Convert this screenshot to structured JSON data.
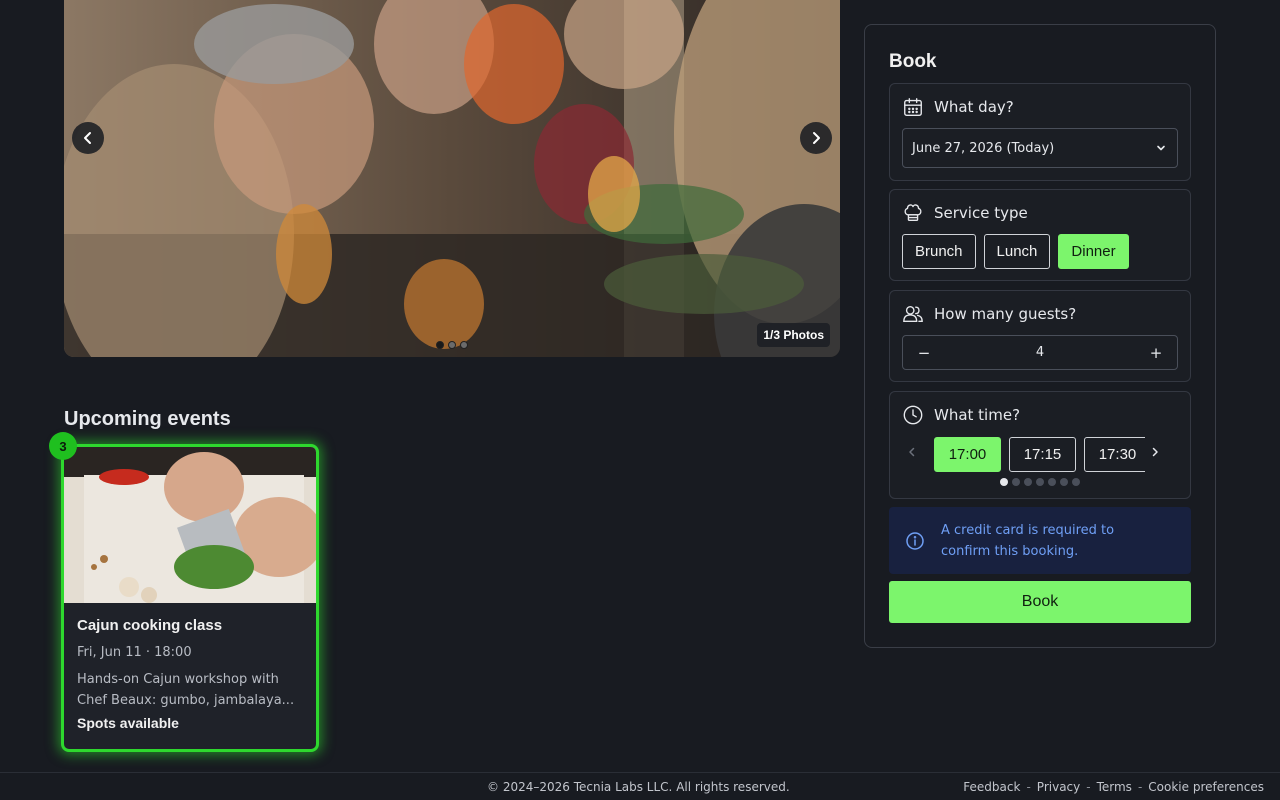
{
  "carousel": {
    "prev_icon": "chevron-left-icon",
    "next_icon": "chevron-right-icon",
    "photo_count": "1/3 Photos",
    "dots": 3,
    "active_dot": 0
  },
  "events": {
    "title": "Upcoming events",
    "badge_count": "3",
    "items": [
      {
        "name": "Cajun cooking class",
        "date": "Fri, Jun 11 · 18:00",
        "description": "Hands-on Cajun workshop with Chef Beaux: gumbo, jambalaya...",
        "availability": "Spots available"
      }
    ]
  },
  "booking": {
    "title": "Book",
    "day": {
      "label": "What day?",
      "icon": "calendar-icon",
      "selected": "June 27, 2026 (Today)"
    },
    "service": {
      "label": "Service type",
      "icon": "chef-hat-icon",
      "options": [
        "Brunch",
        "Lunch",
        "Dinner"
      ],
      "selected": "Dinner"
    },
    "guests": {
      "label": "How many guests?",
      "icon": "users-icon",
      "value": "4",
      "decrement": "−",
      "increment": "+"
    },
    "time": {
      "label": "What time?",
      "icon": "clock-icon",
      "slots": [
        "17:00",
        "17:15",
        "17:30"
      ],
      "selected": "17:00",
      "page_dots": 7,
      "active_page": 0
    },
    "notice": "A credit card is required to confirm this booking.",
    "submit_label": "Book"
  },
  "footer": {
    "copyright": "© 2024–2026 Tecnia Labs LLC. All rights reserved.",
    "links": [
      "Feedback",
      "Privacy",
      "Terms",
      "Cookie preferences"
    ],
    "separator": "-"
  },
  "colors": {
    "accent": "#7cf56c",
    "highlight_border": "#2ed82e",
    "background": "#181b21",
    "notice_bg": "#18213f",
    "notice_text": "#6f9ff5"
  }
}
